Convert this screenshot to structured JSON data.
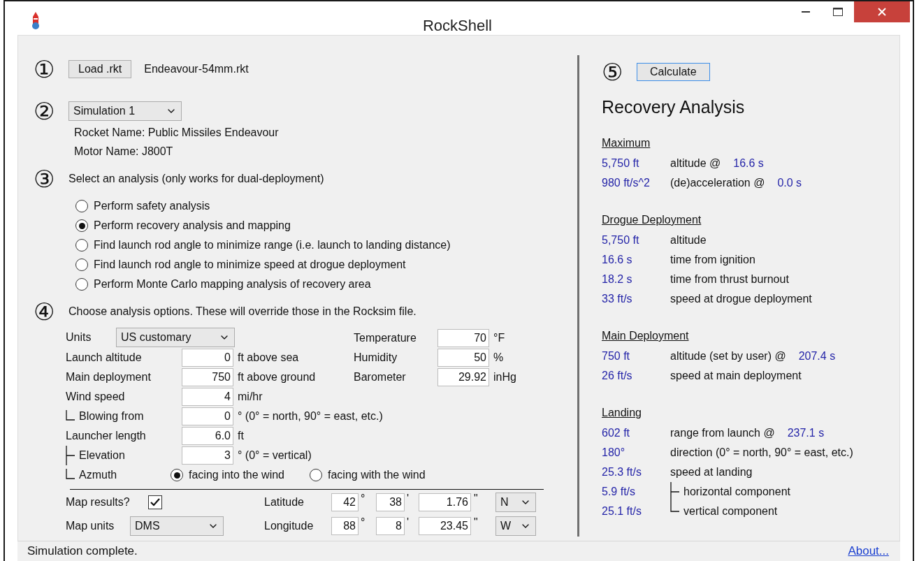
{
  "window": {
    "title": "RockShell"
  },
  "load": {
    "step": "①",
    "button": "Load .rkt",
    "file": "Endeavour-54mm.rkt"
  },
  "simulation": {
    "step": "②",
    "select": "Simulation 1",
    "rocket_name": "Rocket Name: Public Missiles Endeavour",
    "motor_name": "Motor Name: J800T"
  },
  "analysis": {
    "step": "③",
    "prompt": "Select an analysis (only works for dual-deployment)",
    "options": [
      {
        "label": "Perform safety analysis",
        "selected": false
      },
      {
        "label": "Perform recovery analysis and mapping",
        "selected": true
      },
      {
        "label": "Find launch rod angle to minimize range (i.e. launch to landing distance)",
        "selected": false
      },
      {
        "label": "Find launch rod angle to minimize speed at drogue deployment",
        "selected": false
      },
      {
        "label": "Perform Monte Carlo mapping analysis of recovery area",
        "selected": false
      }
    ]
  },
  "options": {
    "step": "④",
    "prompt": "Choose analysis options. These will override those in the Rocksim file.",
    "units_label": "Units",
    "units": "US customary",
    "fields": [
      {
        "label": "Launch altitude",
        "value": "0",
        "unit": "ft above sea"
      },
      {
        "label": "Main deployment",
        "value": "750",
        "unit": "ft above ground"
      },
      {
        "label": "Wind speed",
        "value": "4",
        "unit": "mi/hr"
      },
      {
        "label": "Blowing from",
        "value": "0",
        "unit": "° (0° = north, 90° = east, etc.)",
        "kind": "end"
      },
      {
        "label": "Launcher length",
        "value": "6.0",
        "unit": "ft"
      },
      {
        "label": "Elevation",
        "value": "3",
        "unit": "° (0° = vertical)",
        "kind": "tee"
      }
    ],
    "atmosphere": [
      {
        "label": "Temperature",
        "value": "70",
        "unit": "°F"
      },
      {
        "label": "Humidity",
        "value": "50",
        "unit": "%"
      },
      {
        "label": "Barometer",
        "value": "29.92",
        "unit": "inHg"
      }
    ],
    "azimuth": {
      "label": "Azmuth",
      "kind": "end",
      "choices": [
        {
          "label": "facing into the wind",
          "selected": true
        },
        {
          "label": "facing with the wind",
          "selected": false
        }
      ]
    },
    "map": {
      "label": "Map results?",
      "checked": true,
      "units_label": "Map units",
      "units": "DMS",
      "coords": [
        {
          "label": "Latitude",
          "deg": "42",
          "deg_mark": "°",
          "min": "38",
          "min_mark": "'",
          "sec": "1.76",
          "sec_mark": "\"",
          "hemisphere": "N"
        },
        {
          "label": "Longitude",
          "deg": "88",
          "deg_mark": "°",
          "min": "8",
          "min_mark": "'",
          "sec": "23.45",
          "sec_mark": "\"",
          "hemisphere": "W"
        }
      ]
    }
  },
  "results": {
    "step": "⑤",
    "button": "Calculate",
    "title": "Recovery Analysis",
    "sections": [
      {
        "heading": "Maximum",
        "rows": [
          {
            "value": "5,750 ft",
            "label": "altitude @",
            "time": "16.6 s"
          },
          {
            "value": "980 ft/s^2",
            "label": "(de)acceleration @",
            "time": "0.0 s"
          }
        ]
      },
      {
        "heading": "Drogue Deployment",
        "rows": [
          {
            "value": "5,750 ft",
            "label": "altitude"
          },
          {
            "value": "16.6 s",
            "label": "time from ignition"
          },
          {
            "value": "18.2 s",
            "label": "time from thrust burnout"
          },
          {
            "value": "33 ft/s",
            "label": "speed at drogue deployment"
          }
        ]
      },
      {
        "heading": "Main Deployment",
        "rows": [
          {
            "value": "750 ft",
            "label": "altitude (set by user) @",
            "time": "207.4 s"
          },
          {
            "value": "26 ft/s",
            "label": "speed at main deployment"
          }
        ]
      },
      {
        "heading": "Landing",
        "rows": [
          {
            "value": "602 ft",
            "label": "range from launch @",
            "time": "237.1 s"
          },
          {
            "value": "180°",
            "label": "direction (0° = north, 90° = east, etc.)"
          },
          {
            "value": "25.3 ft/s",
            "label": "speed at landing"
          },
          {
            "value": "5.9 ft/s",
            "label": "horizontal component",
            "kind": "tee"
          },
          {
            "value": "25.1 ft/s",
            "label": "vertical component",
            "kind": "end"
          }
        ]
      }
    ]
  },
  "status_bar": {
    "text": "Simulation complete.",
    "link": "About..."
  }
}
